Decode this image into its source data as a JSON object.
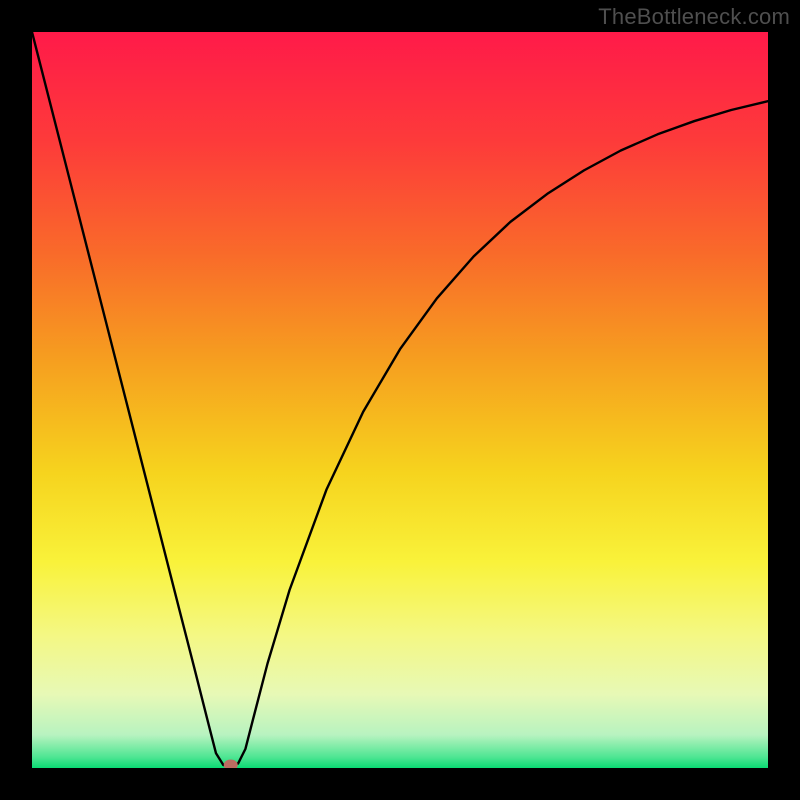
{
  "watermark": "TheBottleneck.com",
  "chart_data": {
    "type": "line",
    "title": "",
    "xlabel": "",
    "ylabel": "",
    "xlim": [
      0,
      100
    ],
    "ylim": [
      0,
      100
    ],
    "grid": false,
    "legend": false,
    "series": [
      {
        "name": "curve",
        "x": [
          0,
          5,
          10,
          15,
          20,
          22,
          24,
          25,
          26,
          27,
          28,
          29,
          30,
          32,
          35,
          40,
          45,
          50,
          55,
          60,
          65,
          70,
          75,
          80,
          85,
          90,
          95,
          100
        ],
        "y": [
          100,
          80.4,
          60.8,
          41.2,
          21.6,
          13.8,
          5.9,
          2.0,
          0.4,
          0.4,
          0.6,
          2.6,
          6.5,
          14.2,
          24.2,
          37.8,
          48.4,
          56.9,
          63.8,
          69.5,
          74.2,
          78.0,
          81.2,
          83.9,
          86.1,
          87.9,
          89.4,
          90.6
        ]
      }
    ],
    "marker": {
      "x": 27,
      "y": 0.4,
      "color": "#bb6c61"
    },
    "gradient_stops": [
      {
        "offset": 0.0,
        "color": "#ff1a49"
      },
      {
        "offset": 0.15,
        "color": "#fd3b3a"
      },
      {
        "offset": 0.3,
        "color": "#f96a2a"
      },
      {
        "offset": 0.45,
        "color": "#f6a01f"
      },
      {
        "offset": 0.6,
        "color": "#f6d41e"
      },
      {
        "offset": 0.72,
        "color": "#f9f23a"
      },
      {
        "offset": 0.82,
        "color": "#f4f884"
      },
      {
        "offset": 0.9,
        "color": "#e7f9b6"
      },
      {
        "offset": 0.955,
        "color": "#b8f3c0"
      },
      {
        "offset": 0.985,
        "color": "#4fe693"
      },
      {
        "offset": 1.0,
        "color": "#0adb73"
      }
    ]
  }
}
